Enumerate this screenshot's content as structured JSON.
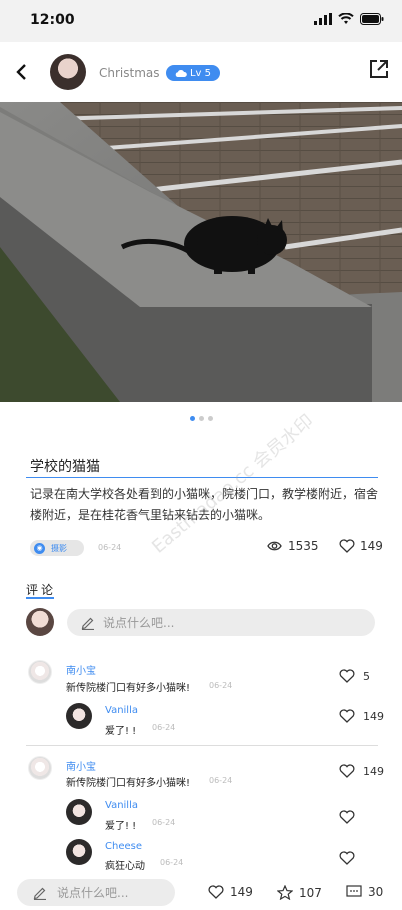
{
  "status": {
    "time": "12:00"
  },
  "header": {
    "username": "Christmas",
    "level": "Lv 5"
  },
  "gallery": {
    "page_count": 3,
    "active_index": 0
  },
  "post": {
    "title": "学校的猫猫",
    "body": "记录在南大学校各处看到的小猫咪，院楼门口，教学楼附近，宿舍楼附近，是在桂花香气里钻来钻去的小猫咪。",
    "tag": "摄影",
    "date": "06-24",
    "views": "1535",
    "likes": "149"
  },
  "comments_section": {
    "header": "评论",
    "input_placeholder": "说点什么吧..."
  },
  "comments": [
    {
      "name": "南小宝",
      "text": "新传院楼门口有好多小猫咪!",
      "time": "06-24",
      "likes": "5",
      "replies": [
        {
          "name": "Vanilla",
          "text": "爱了! !",
          "time": "06-24",
          "likes": "149"
        }
      ]
    },
    {
      "name": "南小宝",
      "text": "新传院楼门口有好多小猫咪!",
      "time": "06-24",
      "likes": "149",
      "replies": [
        {
          "name": "Vanilla",
          "text": "爱了! !",
          "time": "06-24",
          "likes": ""
        },
        {
          "name": "Cheese",
          "text": "疯狂心动",
          "time": "06-24",
          "likes": ""
        }
      ]
    }
  ],
  "bottom_bar": {
    "placeholder": "说点什么吧...",
    "likes": "149",
    "favorites": "107",
    "comments": "30"
  },
  "watermark": "Eastmadao.cc 会员水印",
  "colors": {
    "accent": "#3f8cf0"
  }
}
